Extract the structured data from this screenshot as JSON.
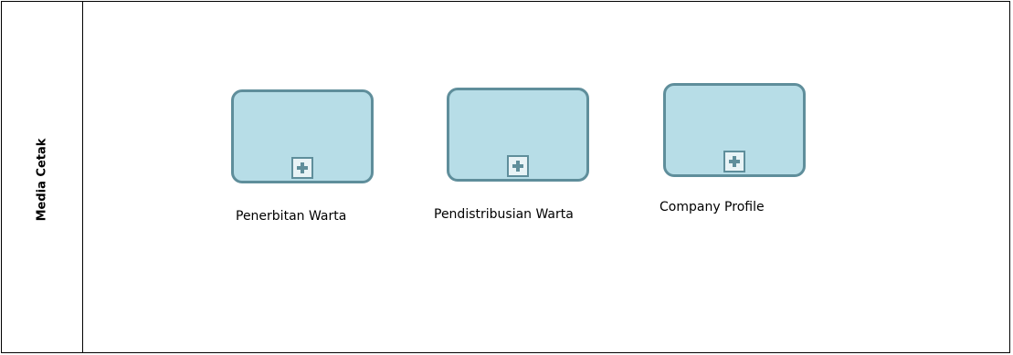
{
  "lane": {
    "label": "Media Cetak"
  },
  "tasks": [
    {
      "label": "Penerbitan Warta",
      "marker_icon": "plus-icon"
    },
    {
      "label": "Pendistribusian Warta",
      "marker_icon": "plus-icon"
    },
    {
      "label": "Company Profile",
      "marker_icon": "plus-icon"
    }
  ],
  "colors": {
    "task_fill": "#b7dde7",
    "task_border": "#5f8e9b",
    "lines": "#000000"
  }
}
